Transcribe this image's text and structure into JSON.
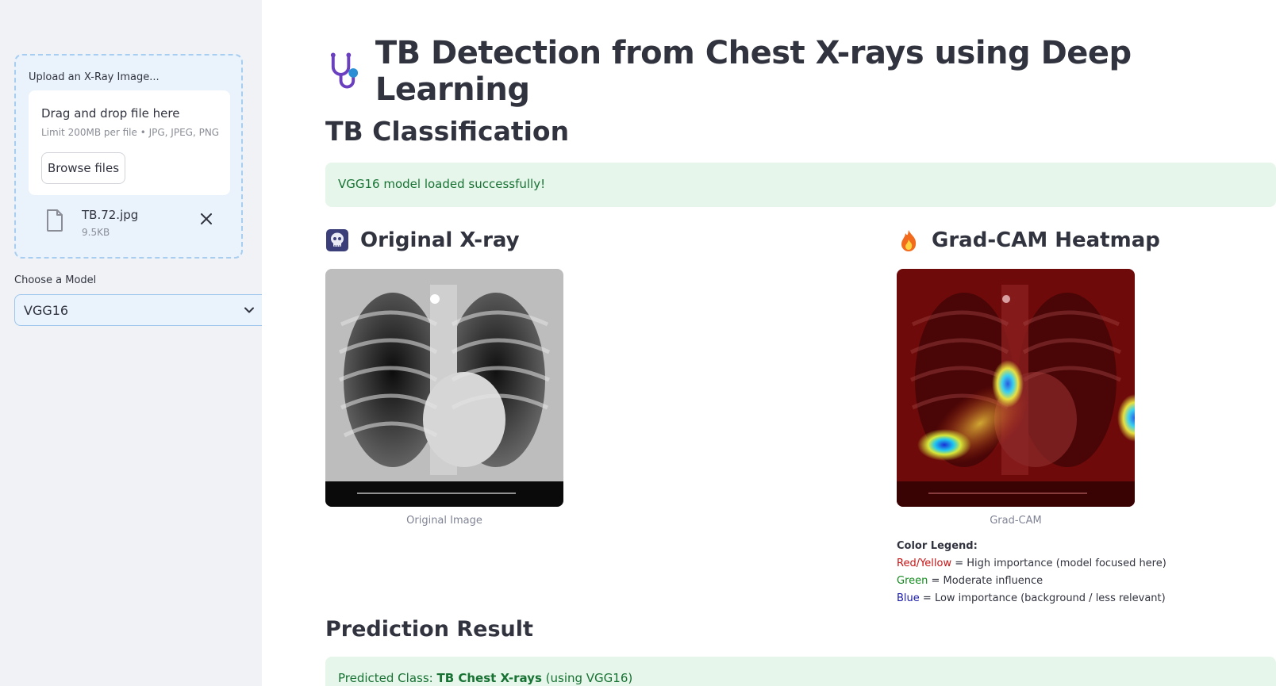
{
  "sidebar": {
    "uploader": {
      "label": "Upload an X-Ray Image...",
      "drop_title": "Drag and drop file here",
      "limit_text": "Limit 200MB per file • JPG, JPEG, PNG",
      "browse_label": "Browse files",
      "file": {
        "name": "TB.72.jpg",
        "size": "9.5KB"
      }
    },
    "model": {
      "label": "Choose a Model",
      "selected": "VGG16"
    }
  },
  "main": {
    "title": "TB Detection from Chest X-rays using Deep Learning",
    "classification_heading": "TB Classification",
    "load_message": "VGG16 model loaded successfully!",
    "original": {
      "heading": "Original X-ray",
      "caption": "Original Image"
    },
    "gradcam": {
      "heading": "Grad-CAM Heatmap",
      "caption": "Grad-CAM"
    },
    "legend": {
      "title": "Color Legend:",
      "items": [
        {
          "key": "Red/Yellow",
          "desc": "= High importance (model focused here)",
          "color": "#c81414"
        },
        {
          "key": "Green",
          "desc": "= Moderate influence",
          "color": "#138a1e"
        },
        {
          "key": "Blue",
          "desc": "= Low importance (background / less relevant)",
          "color": "#1a1aa8"
        }
      ]
    },
    "prediction": {
      "heading": "Prediction Result",
      "prefix": "Predicted Class: ",
      "class_name": "TB Chest X-rays",
      "suffix": " (using VGG16)"
    }
  },
  "colors": {
    "sidebar_bg": "#f0f2f6",
    "success_bg": "#e6f6ea",
    "success_text": "#177233",
    "accent_blue": "#a7cdf0"
  },
  "icons": {
    "title": "stethoscope-icon",
    "original": "skull-xray-icon",
    "gradcam": "fire-icon",
    "file": "file-icon",
    "close": "close-icon",
    "select": "chevron-down-icon"
  }
}
